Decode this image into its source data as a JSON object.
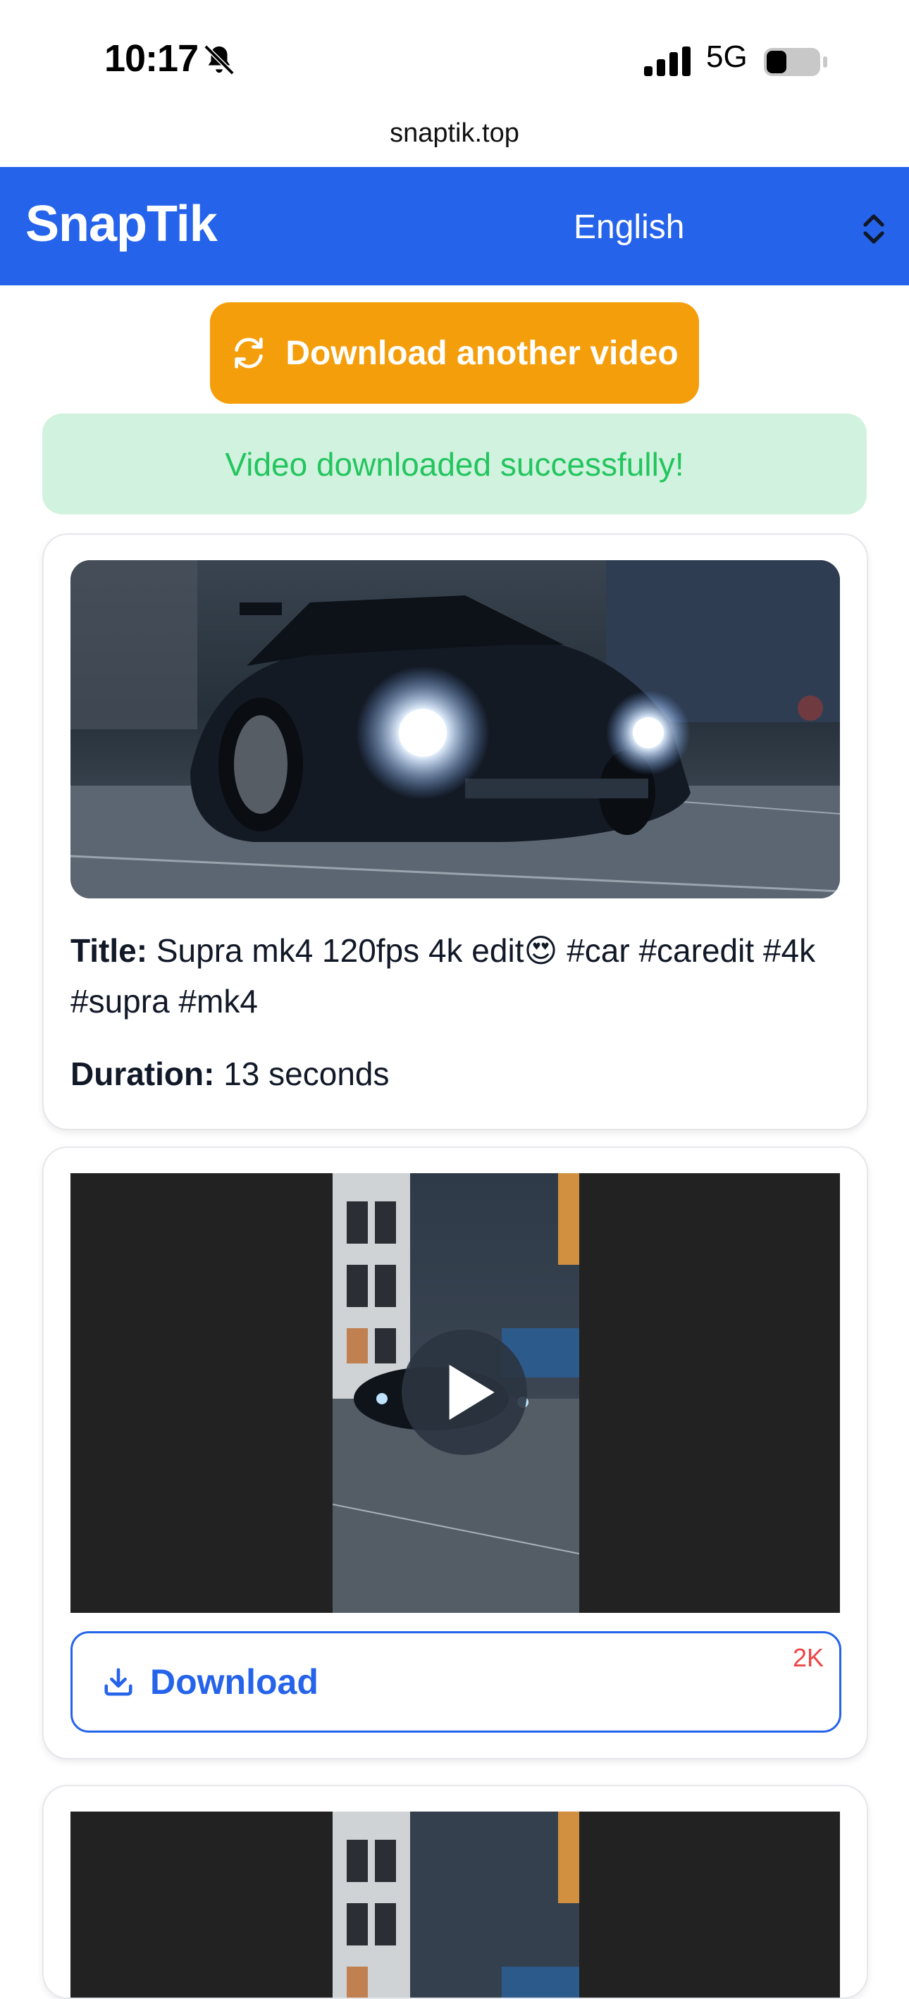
{
  "status_bar": {
    "time": "10:17",
    "network": "5G"
  },
  "browser": {
    "url": "snaptik.top"
  },
  "header": {
    "brand": "SnapTik",
    "language": "English"
  },
  "actions": {
    "download_another": "Download another video"
  },
  "alert": {
    "success_text": "Video downloaded successfully!"
  },
  "video_info": {
    "title_label": "Title:",
    "title_value": "Supra mk4 120fps 4k edit😍 #car #caredit #4k #supra #mk4",
    "duration_label": "Duration:",
    "duration_value": "13 seconds"
  },
  "downloads": [
    {
      "label": "Download",
      "badge": "2K"
    }
  ],
  "colors": {
    "header": "#2563eb",
    "accent": "#f59e0b",
    "success_bg": "#d1f2de",
    "success_text": "#22c55e",
    "badge": "#ef4444"
  },
  "icons": [
    "bell-slash-icon",
    "signal-icon",
    "battery-icon",
    "chevron-updown-icon",
    "refresh-icon",
    "play-icon",
    "download-icon"
  ]
}
